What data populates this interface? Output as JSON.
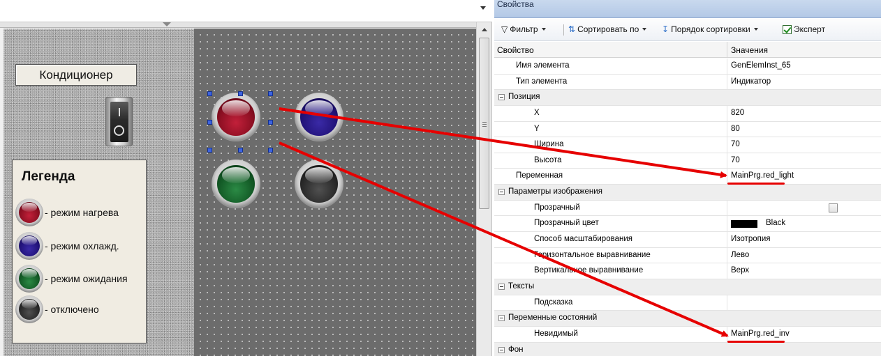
{
  "editor": {
    "title_box": "Кондиционер",
    "legend": {
      "title": "Легенда",
      "items": [
        {
          "color": "red",
          "label": "- режим нагрева"
        },
        {
          "color": "blue",
          "label": "- режим охлажд."
        },
        {
          "color": "green",
          "label": "- режим ожидания"
        },
        {
          "color": "black",
          "label": "- отключено"
        }
      ]
    },
    "lamps": [
      "red",
      "blue",
      "green",
      "black"
    ]
  },
  "properties": {
    "title": "Свойства",
    "toolbar": {
      "filter": "Фильтр",
      "sort_by": "Сортировать по",
      "sort_order": "Порядок сортировки",
      "expert": "Эксперт"
    },
    "columns": {
      "property": "Свойство",
      "value": "Значения"
    },
    "rows": [
      {
        "type": "prop",
        "indent": 1,
        "name": "Имя элемента",
        "value": "GenElemInst_65"
      },
      {
        "type": "prop",
        "indent": 1,
        "name": "Тип элемента",
        "value": "Индикатор"
      },
      {
        "type": "cat",
        "name": "Позиция"
      },
      {
        "type": "prop",
        "indent": 2,
        "name": "X",
        "value": "820"
      },
      {
        "type": "prop",
        "indent": 2,
        "name": "Y",
        "value": "80"
      },
      {
        "type": "prop",
        "indent": 2,
        "name": "Ширина",
        "value": "70"
      },
      {
        "type": "prop",
        "indent": 2,
        "name": "Высота",
        "value": "70"
      },
      {
        "type": "prop",
        "indent": 1,
        "name": "Переменная",
        "value": "MainPrg.red_light",
        "highlight": true
      },
      {
        "type": "cat",
        "name": "Параметры изображения"
      },
      {
        "type": "prop",
        "indent": 2,
        "name": "Прозрачный",
        "value": "",
        "checkbox": true
      },
      {
        "type": "prop",
        "indent": 2,
        "name": "Прозрачный цвет",
        "value": "Black",
        "swatch": "#000000"
      },
      {
        "type": "prop",
        "indent": 2,
        "name": "Способ масштабирования",
        "value": "Изотропия"
      },
      {
        "type": "prop",
        "indent": 2,
        "name": "Горизонтальное выравнивание",
        "value": "Лево"
      },
      {
        "type": "prop",
        "indent": 2,
        "name": "Вертикальное выравнивание",
        "value": "Верх"
      },
      {
        "type": "cat",
        "name": "Тексты"
      },
      {
        "type": "prop",
        "indent": 2,
        "name": "Подсказка",
        "value": ""
      },
      {
        "type": "cat",
        "name": "Переменные состояний"
      },
      {
        "type": "prop",
        "indent": 2,
        "name": "Невидимый",
        "value": "MainPrg.red_inv",
        "highlight": true
      },
      {
        "type": "cat",
        "name": "Фон"
      }
    ]
  },
  "colors": {
    "arrow": "#e60000",
    "selection_handle": "#3d63e0"
  }
}
